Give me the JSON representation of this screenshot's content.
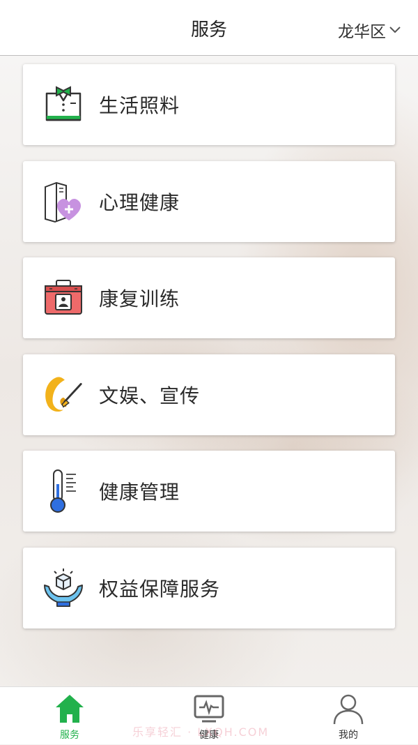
{
  "header": {
    "title": "服务",
    "location": "龙华区"
  },
  "services": [
    {
      "label": "生活照料",
      "icon": "butler-icon"
    },
    {
      "label": "心理健康",
      "icon": "heart-plus-icon"
    },
    {
      "label": "康复训练",
      "icon": "toolbox-icon"
    },
    {
      "label": "文娱、宣传",
      "icon": "brush-icon"
    },
    {
      "label": "健康管理",
      "icon": "thermometer-icon"
    },
    {
      "label": "权益保障服务",
      "icon": "hands-cube-icon"
    }
  ],
  "tabbar": {
    "items": [
      {
        "label": "服务",
        "icon": "home-icon",
        "active": true
      },
      {
        "label": "健康",
        "icon": "monitor-icon",
        "active": false
      },
      {
        "label": "我的",
        "icon": "user-icon",
        "active": false
      }
    ]
  },
  "watermark": "乐享轻汇 · LXQH.COM",
  "colors": {
    "accent": "#22b14c",
    "text": "#2a2a2a"
  }
}
